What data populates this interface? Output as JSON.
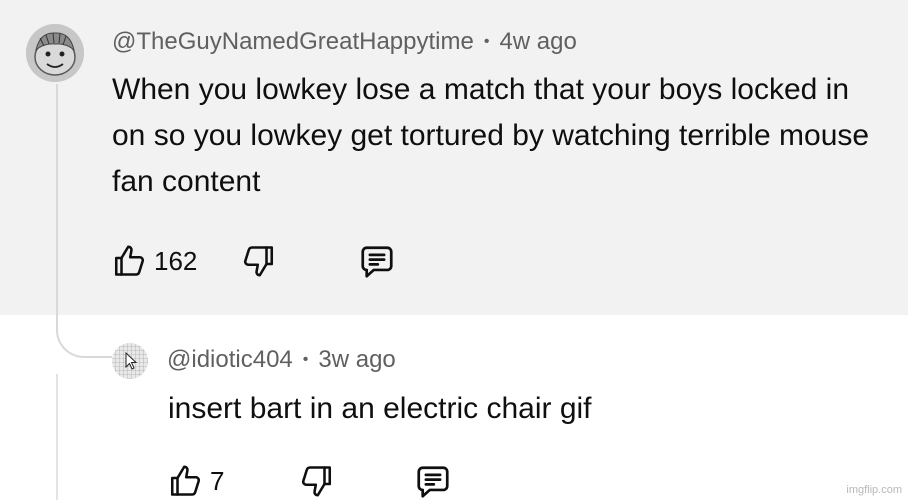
{
  "comment": {
    "handle": "@TheGuyNamedGreatHappytime",
    "time": "4w ago",
    "text": "When you lowkey lose a match that your boys locked in on so you lowkey get tortured by watching terrible mouse fan content",
    "likes": "162",
    "avatar_icon": "cartoon-face-avatar"
  },
  "reply": {
    "handle": "@idiotic404",
    "time": "3w ago",
    "text": "insert bart in an electric chair gif",
    "likes": "7",
    "avatar_icon": "pixel-grid-cursor-avatar"
  },
  "separator": "•",
  "watermark": "imgflip.com",
  "colors": {
    "highlight_bg": "#f2f2f2",
    "meta_text": "#606060",
    "body_text": "#0f0f0f"
  }
}
